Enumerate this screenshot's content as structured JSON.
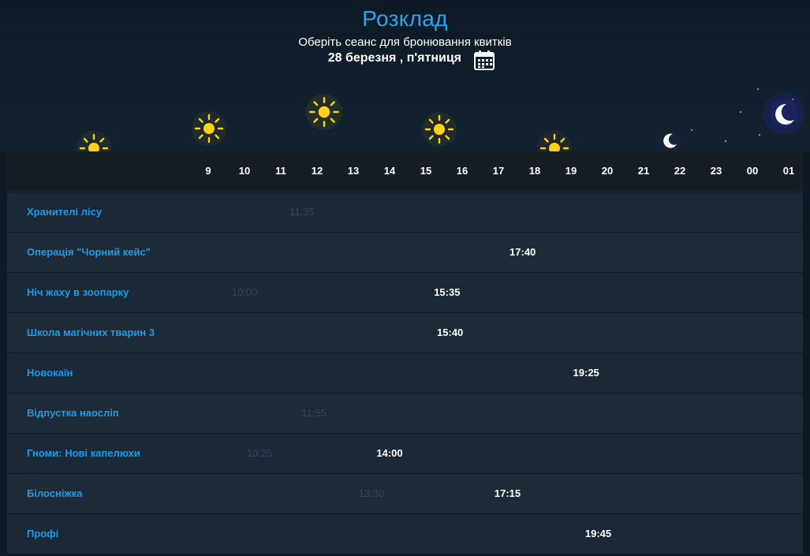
{
  "header": {
    "title": "Розклад",
    "subtitle": "Оберіть сеанс для бронювання квитків",
    "date": "28 березня , п'ятниця",
    "calendar_icon": "calendar-icon"
  },
  "sky_icons": [
    "sun-icon",
    "sun-icon",
    "sun-icon",
    "sun-icon",
    "sun-icon",
    "moon-icon",
    "moon-icon"
  ],
  "hours": [
    "9",
    "10",
    "11",
    "12",
    "13",
    "14",
    "15",
    "16",
    "17",
    "18",
    "19",
    "20",
    "21",
    "22",
    "23",
    "00",
    "01"
  ],
  "movies": [
    {
      "title": "Хранителі лісу",
      "sessions": [
        {
          "time": "11:35",
          "status": "past"
        }
      ]
    },
    {
      "title": "Операція \"Чорний кейс\"",
      "sessions": [
        {
          "time": "17:40",
          "status": "active"
        }
      ]
    },
    {
      "title": "Ніч жаху в зоопарку",
      "sessions": [
        {
          "time": "10:00",
          "status": "past"
        },
        {
          "time": "15:35",
          "status": "active"
        }
      ]
    },
    {
      "title": "Школа магічних тварин 3",
      "sessions": [
        {
          "time": "15:40",
          "status": "active"
        }
      ]
    },
    {
      "title": "Новокаїн",
      "sessions": [
        {
          "time": "19:25",
          "status": "active"
        }
      ]
    },
    {
      "title": "Відпустка наосліп",
      "sessions": [
        {
          "time": "11:55",
          "status": "past"
        }
      ]
    },
    {
      "title": "Гноми: Нові капелюхи",
      "sessions": [
        {
          "time": "10:25",
          "status": "past"
        },
        {
          "time": "14:00",
          "status": "active"
        }
      ]
    },
    {
      "title": "Білосніжка",
      "sessions": [
        {
          "time": "13:30",
          "status": "past"
        },
        {
          "time": "17:15",
          "status": "active"
        }
      ]
    },
    {
      "title": "Профі",
      "sessions": [
        {
          "time": "19:45",
          "status": "active"
        }
      ]
    }
  ],
  "colors": {
    "accent": "#2aa6f2",
    "movie_link": "#1f9ce8",
    "past_session": "#34495e",
    "active_session": "#ffffff",
    "sun": "#ffd21a",
    "moon": "#ffffff"
  }
}
